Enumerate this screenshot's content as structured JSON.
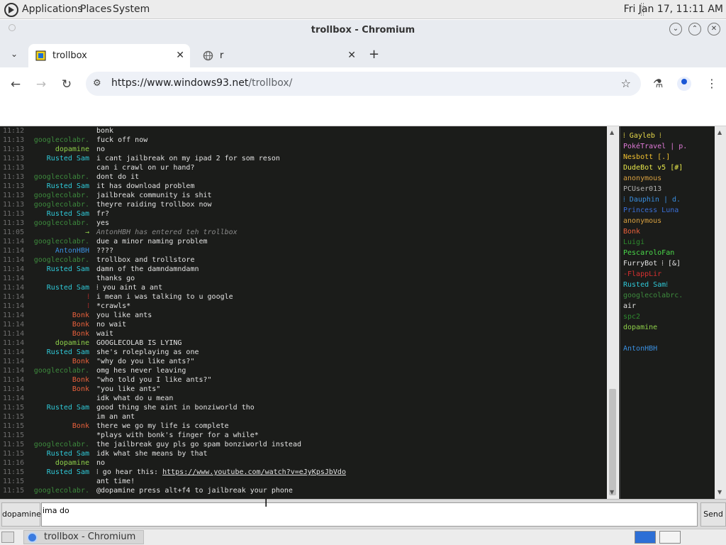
{
  "panel": {
    "menus": [
      "Applications",
      "Places",
      "System"
    ],
    "clock": "Fri Jan 17, 11:11 AM"
  },
  "window": {
    "title": "trollbox - Chromium"
  },
  "tabs": [
    {
      "label": "trollbox",
      "active": true
    },
    {
      "label": "r",
      "active": false
    }
  ],
  "toolbar": {
    "url_host": "https://www.windows93.net",
    "url_path": "/trollbox/"
  },
  "chat": {
    "messages": [
      {
        "time": "11:12",
        "nick": "",
        "nick_color": "#e2e2e2",
        "text": "bonk",
        "system": false
      },
      {
        "time": "11:13",
        "nick": "googlecolabr.",
        "nick_color": "#3d8a3d",
        "text": "fuck off now",
        "system": false
      },
      {
        "time": "11:13",
        "nick": "dopamine",
        "nick_color": "#8fd14a",
        "text": "no",
        "system": false
      },
      {
        "time": "11:13",
        "nick": "Rusted Sam",
        "nick_color": "#2fc9d8",
        "text": "i cant jailbreak on my ipad 2 for som reson",
        "system": false
      },
      {
        "time": "11:13",
        "nick": "",
        "nick_color": "#e2e2e2",
        "text": "can i crawl on ur hand?",
        "system": false
      },
      {
        "time": "11:13",
        "nick": "googlecolabr.",
        "nick_color": "#3d8a3d",
        "text": "dont do it",
        "system": false
      },
      {
        "time": "11:13",
        "nick": "Rusted Sam",
        "nick_color": "#2fc9d8",
        "text": "it has download problem",
        "system": false
      },
      {
        "time": "11:13",
        "nick": "googlecolabr.",
        "nick_color": "#3d8a3d",
        "text": "jailbreak community is shit",
        "system": false
      },
      {
        "time": "11:13",
        "nick": "googlecolabr.",
        "nick_color": "#3d8a3d",
        "text": "theyre raiding trollbox now",
        "system": false
      },
      {
        "time": "11:13",
        "nick": "Rusted Sam",
        "nick_color": "#2fc9d8",
        "text": "fr?",
        "system": false
      },
      {
        "time": "11:13",
        "nick": "googlecolabr.",
        "nick_color": "#3d8a3d",
        "text": "yes",
        "system": false
      },
      {
        "time": "11:05",
        "nick": "→",
        "nick_color": "#8fd14a",
        "text": "AntonHBH has entered teh trollbox",
        "system": true
      },
      {
        "time": "11:14",
        "nick": "googlecolabr.",
        "nick_color": "#3d8a3d",
        "text": "due a minor naming problem",
        "system": false
      },
      {
        "time": "11:14",
        "nick": "AntonHBH",
        "nick_color": "#3a8fe0",
        "text": "????",
        "system": false
      },
      {
        "time": "11:14",
        "nick": "googlecolabr.",
        "nick_color": "#3d8a3d",
        "text": "trollbox and trollstore",
        "system": false
      },
      {
        "time": "11:14",
        "nick": "Rusted Sam",
        "nick_color": "#2fc9d8",
        "text": "damn of the damndamndamn",
        "system": false
      },
      {
        "time": "11:14",
        "nick": "",
        "nick_color": "#e2e2e2",
        "text": "thanks go",
        "system": false
      },
      {
        "time": "11:14",
        "nick": "Rusted Sam",
        "nick_color": "#2fc9d8",
        "text": "⁞ you aint a ant",
        "system": false
      },
      {
        "time": "11:14",
        "nick": "⁞",
        "nick_color": "#d03030",
        "text": "i mean i was talking to u google",
        "system": false
      },
      {
        "time": "11:14",
        "nick": "⁞",
        "nick_color": "#d03030",
        "text": "*crawls*",
        "system": false
      },
      {
        "time": "11:14",
        "nick": "Bonk",
        "nick_color": "#e8603c",
        "text": "you like ants",
        "system": false
      },
      {
        "time": "11:14",
        "nick": "Bonk",
        "nick_color": "#e8603c",
        "text": "no wait",
        "system": false
      },
      {
        "time": "11:14",
        "nick": "Bonk",
        "nick_color": "#e8603c",
        "text": "wait",
        "system": false
      },
      {
        "time": "11:14",
        "nick": "dopamine",
        "nick_color": "#8fd14a",
        "text": "GOOGLECOLAB IS LYING",
        "system": false
      },
      {
        "time": "11:14",
        "nick": "Rusted Sam",
        "nick_color": "#2fc9d8",
        "text": "she's roleplaying as one",
        "system": false
      },
      {
        "time": "11:14",
        "nick": "Bonk",
        "nick_color": "#e8603c",
        "text": "\"why do you like ants?\"",
        "system": false
      },
      {
        "time": "11:14",
        "nick": "googlecolabr.",
        "nick_color": "#3d8a3d",
        "text": "omg hes never leaving",
        "system": false
      },
      {
        "time": "11:14",
        "nick": "Bonk",
        "nick_color": "#e8603c",
        "text": "\"who told you I like ants?\"",
        "system": false
      },
      {
        "time": "11:14",
        "nick": "Bonk",
        "nick_color": "#e8603c",
        "text": "\"you like ants\"",
        "system": false
      },
      {
        "time": "11:14",
        "nick": "",
        "nick_color": "#e2e2e2",
        "text": "idk what do u mean",
        "system": false
      },
      {
        "time": "11:15",
        "nick": "Rusted Sam",
        "nick_color": "#2fc9d8",
        "text": "good thing she aint in bonziworld tho",
        "system": false
      },
      {
        "time": "11:15",
        "nick": "",
        "nick_color": "#e2e2e2",
        "text": "im an ant",
        "system": false
      },
      {
        "time": "11:15",
        "nick": "Bonk",
        "nick_color": "#e8603c",
        "text": "there we go my life is complete",
        "system": false
      },
      {
        "time": "11:15",
        "nick": "",
        "nick_color": "#e2e2e2",
        "text": "*plays with bonk's finger for a while*",
        "system": false
      },
      {
        "time": "11:15",
        "nick": "googlecolabr.",
        "nick_color": "#3d8a3d",
        "text": "the jailbreak guy pls go spam bonziworld instead",
        "system": false
      },
      {
        "time": "11:15",
        "nick": "Rusted Sam",
        "nick_color": "#2fc9d8",
        "text": "idk what she means by that",
        "system": false
      },
      {
        "time": "11:16",
        "nick": "dopamine",
        "nick_color": "#8fd14a",
        "text": "no",
        "system": false
      },
      {
        "time": "11:15",
        "nick": "Rusted Sam",
        "nick_color": "#2fc9d8",
        "text": "⁞ go hear this: ",
        "link": "https://www.youtube.com/watch?v=eJyKpsJbVdo",
        "system": false
      },
      {
        "time": "11:15",
        "nick": "",
        "nick_color": "#e2e2e2",
        "text": "ant time!",
        "system": false
      },
      {
        "time": "11:15",
        "nick": "googlecolabr.",
        "nick_color": "#3d8a3d",
        "text": "@dopamine press alt+f4 to jailbreak your phone",
        "system": false
      }
    ]
  },
  "users": [
    {
      "name": "⁞ Gayleb ⁞",
      "color": "#e6d84a"
    },
    {
      "name": "PokéTravel | p.",
      "color": "#e07ad8"
    },
    {
      "name": "Nesbott [.]",
      "color": "#f0c030"
    },
    {
      "name": "DudeBot v5 [#]",
      "color": "#e6e64a"
    },
    {
      "name": "anonymous",
      "color": "#d8a040"
    },
    {
      "name": "PCUser013",
      "color": "#b0b0b0"
    },
    {
      "name": "⁞ Dauphin | d.",
      "color": "#3a8fe0"
    },
    {
      "name": "Princess Luna",
      "color": "#3a6fd8"
    },
    {
      "name": "anonymous",
      "color": "#d8a040"
    },
    {
      "name": "Bonk",
      "color": "#e8603c"
    },
    {
      "name": "Luigi",
      "color": "#2e8a2e"
    },
    {
      "name": "PescaroloFan",
      "color": "#4ad84a"
    },
    {
      "name": "FurryBot ⁞ [&]",
      "color": "#e2e2e2"
    },
    {
      "name": "-FlappLir",
      "color": "#d83030"
    },
    {
      "name": "Rusted Sam⁞",
      "color": "#2fc9d8"
    },
    {
      "name": "googlecolabrc.",
      "color": "#3d8a3d"
    },
    {
      "name": "air",
      "color": "#e2e2e2"
    },
    {
      "name": "spc2",
      "color": "#2e8a2e"
    },
    {
      "name": "dopamine",
      "color": "#8fd14a"
    },
    {
      "name": "",
      "color": "#e2e2e2"
    },
    {
      "name": "AntonHBH",
      "color": "#3a8fe0"
    }
  ],
  "input": {
    "nick_label": "dopamine",
    "value": "ima do",
    "send_label": "Send"
  },
  "taskbar": {
    "task_label": "trollbox - Chromium"
  }
}
